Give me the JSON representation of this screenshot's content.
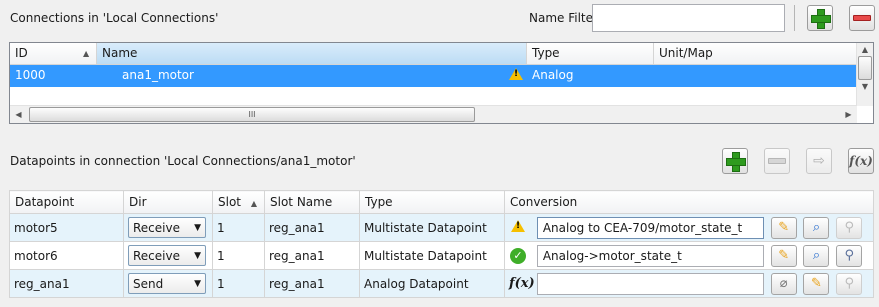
{
  "connections": {
    "title": "Connections in 'Local Connections'",
    "name_filter_label": "Name Filter",
    "name_filter_value": "",
    "columns": [
      "ID",
      "Name",
      "Type",
      "Unit/Map"
    ],
    "rows": [
      {
        "id": "1000",
        "name": "ana1_motor",
        "type": "Analog",
        "unit_map": ""
      }
    ],
    "scroll_thumb_glyph": "III"
  },
  "datapoints": {
    "title": "Datapoints in connection 'Local Connections/ana1_motor'",
    "fx_label": "f(x)",
    "columns": [
      "Datapoint",
      "Dir",
      "Slot",
      "Slot Name",
      "Type",
      "Conversion"
    ],
    "rows": [
      {
        "datapoint": "motor5",
        "dir": "Receive",
        "slot": "1",
        "slot_name": "reg_ana1",
        "type": "Multistate Datapoint",
        "status": "warning",
        "conversion": "Analog to CEA-709/motor_state_t"
      },
      {
        "datapoint": "motor6",
        "dir": "Receive",
        "slot": "1",
        "slot_name": "reg_ana1",
        "type": "Multistate Datapoint",
        "status": "ok",
        "conversion": "Analog->motor_state_t"
      },
      {
        "datapoint": "reg_ana1",
        "dir": "Send",
        "slot": "1",
        "slot_name": "reg_ana1",
        "type": "Analog Datapoint",
        "status": "function",
        "conversion": ""
      }
    ]
  },
  "colors": {
    "selection": "#3399ff",
    "row_highlight": "#e5f3fb",
    "add_green": "#2e9b1e",
    "remove_red": "#e84a4a"
  }
}
